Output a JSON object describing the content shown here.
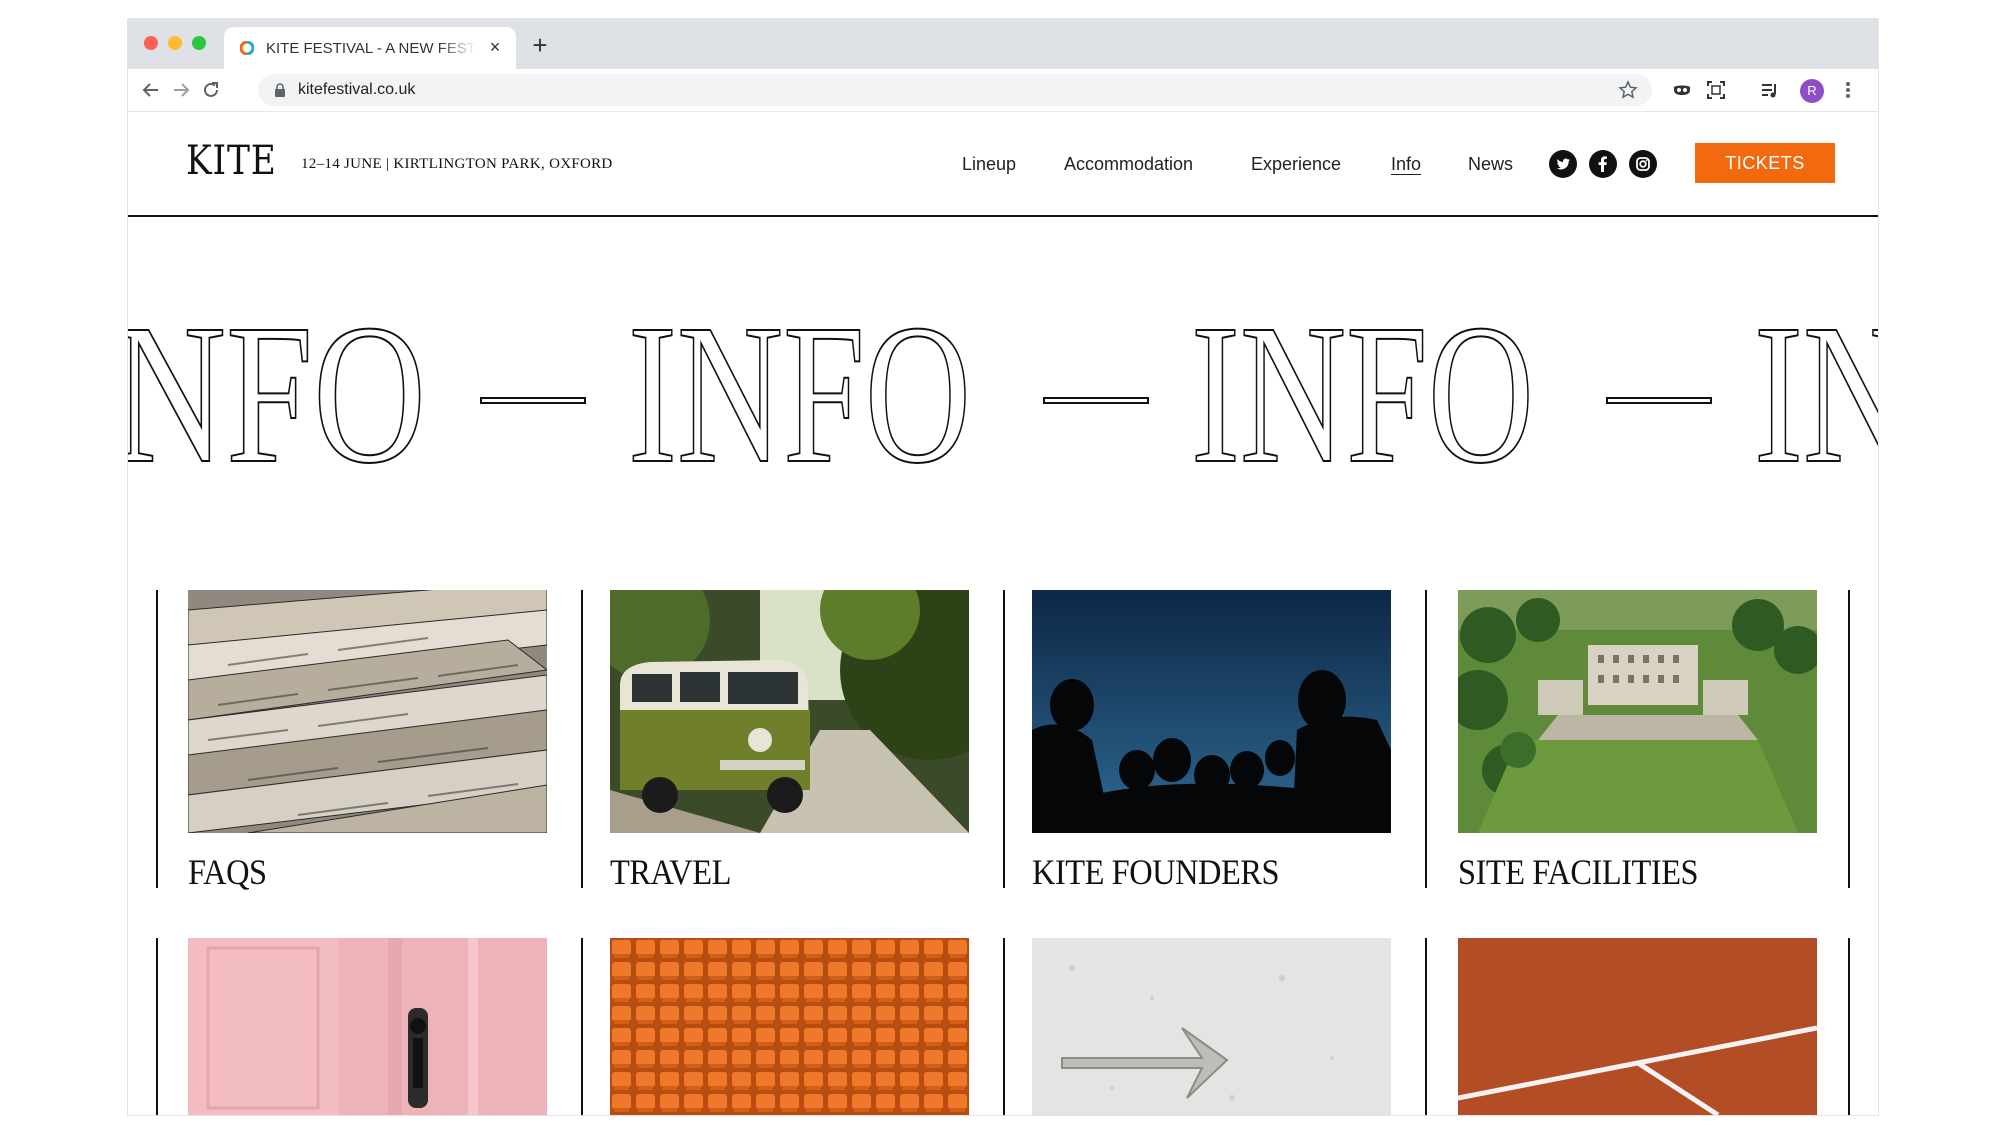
{
  "browser": {
    "tab_title": "KITE FESTIVAL - A NEW FESTIVAL",
    "url": "kitefestival.co.uk",
    "profile_initial": "R"
  },
  "site": {
    "logo": "KITE",
    "event_info": "12–14 JUNE  |  KIRTLINGTON PARK, OXFORD",
    "nav": [
      {
        "label": "Lineup",
        "active": false
      },
      {
        "label": "Accommodation",
        "active": false
      },
      {
        "label": "Experience",
        "active": false
      },
      {
        "label": "Info",
        "active": true
      },
      {
        "label": "News",
        "active": false
      }
    ],
    "social_icons": [
      "twitter-icon",
      "facebook-icon",
      "instagram-icon"
    ],
    "tickets_label": "TICKETS",
    "accent_color": "#f26a10"
  },
  "hero": {
    "marquee_text": "INFO",
    "separator": "—"
  },
  "cards_row1": [
    {
      "title": "FAQS",
      "image": "stacked-newspapers"
    },
    {
      "title": "TRAVEL",
      "image": "green-camper-van"
    },
    {
      "title": "KITE FOUNDERS",
      "image": "silhouettes-against-blue-sky"
    },
    {
      "title": "SITE FACILITIES",
      "image": "aerial-view-stately-home"
    }
  ],
  "cards_row2": [
    {
      "image": "pink-door-with-handle"
    },
    {
      "image": "orange-theatre-seats"
    },
    {
      "image": "arrow-on-concrete"
    },
    {
      "image": "clay-tennis-court"
    }
  ]
}
